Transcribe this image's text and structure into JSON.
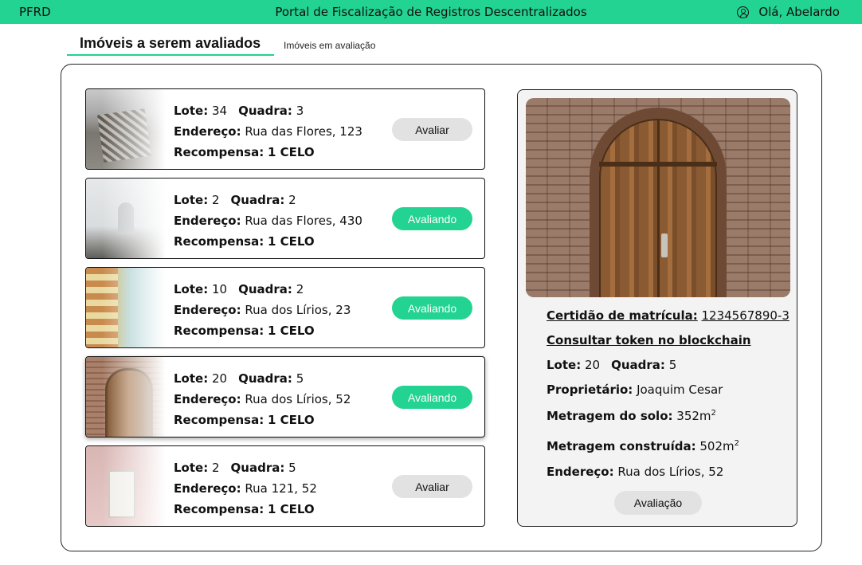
{
  "header": {
    "brand": "PFRD",
    "title": "Portal de Fiscalização de Registros Descentralizados",
    "greeting": "Olá, Abelardo"
  },
  "tabs": {
    "active": "Imóveis a serem avaliados",
    "inactive": "Imóveis em avaliação"
  },
  "labels": {
    "lote": "Lote:",
    "quadra": "Quadra:",
    "endereco": "Endereço:",
    "recompensa": "Recompensa:"
  },
  "properties": [
    {
      "lote": "34",
      "quadra": "3",
      "endereco": "Rua das Flores, 123",
      "recompensa": "1 CELO",
      "button": "Avaliar"
    },
    {
      "lote": "2",
      "quadra": "2",
      "endereco": "Rua das Flores, 430",
      "recompensa": "1 CELO",
      "button": "Avaliando"
    },
    {
      "lote": "10",
      "quadra": "2",
      "endereco": "Rua dos Lírios, 23",
      "recompensa": "1 CELO",
      "button": "Avaliando"
    },
    {
      "lote": "20",
      "quadra": "5",
      "endereco": "Rua dos Lírios, 52",
      "recompensa": "1 CELO",
      "button": "Avaliando"
    },
    {
      "lote": "2",
      "quadra": "5",
      "endereco": "Rua 121, 52",
      "recompensa": "1 CELO",
      "button": "Avaliar"
    }
  ],
  "detail": {
    "certidao_label": "Certidão de matrícula:",
    "certidao_value": "1234567890-3",
    "blockchain_link": "Consultar token no blockchain",
    "lote": "20",
    "quadra": "5",
    "proprietario_label": "Proprietário:",
    "proprietario": "Joaquim Cesar",
    "solo_label": "Metragem do solo:",
    "solo_value": "352m",
    "construida_label": "Metragem construída:",
    "construida_value": "502m",
    "unit_exp": "2",
    "endereco": "Rua dos Lírios, 52",
    "button": "Avaliação"
  },
  "colors": {
    "accent": "#22d391",
    "button_gray": "#e2e2e2"
  }
}
